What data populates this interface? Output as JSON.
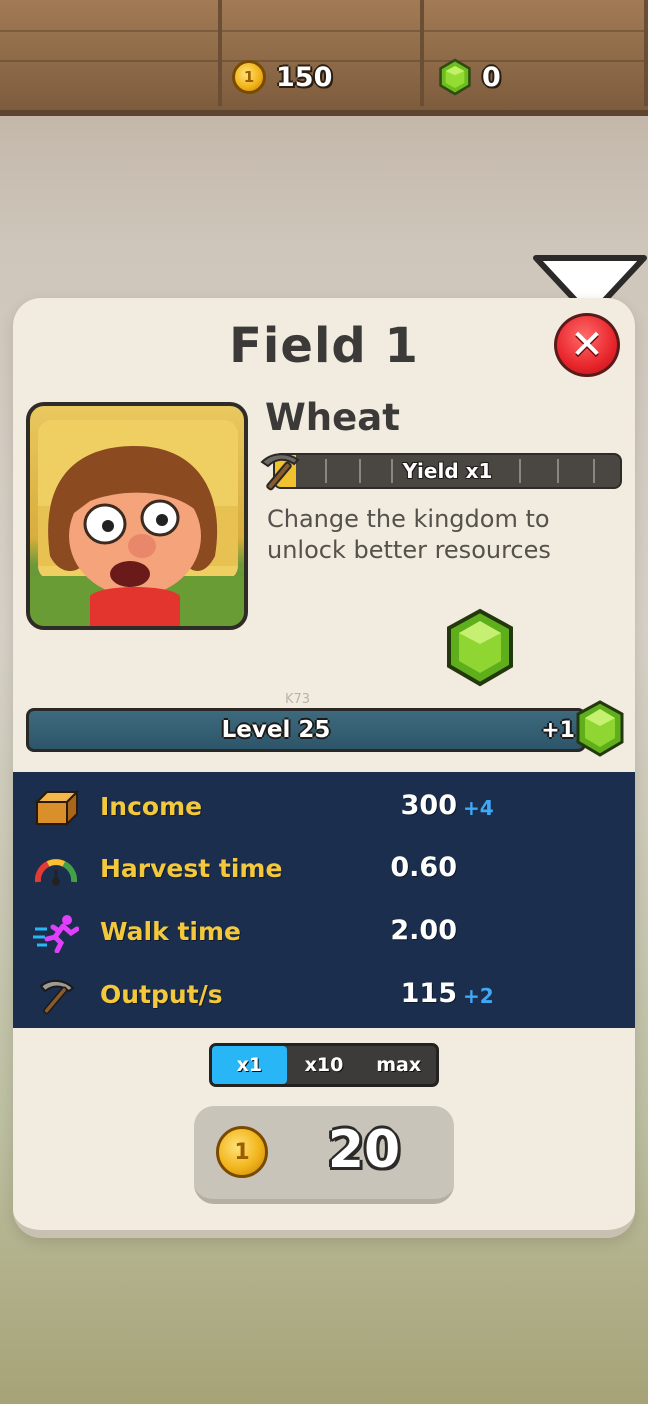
{
  "hud": {
    "coins": "150",
    "gems": "0",
    "coin_icon": "gold-coin-icon",
    "gem_icon": "green-gem-icon"
  },
  "panel": {
    "title": "Field 1",
    "close_icon": "close-x-icon"
  },
  "crop": {
    "name": "Wheat",
    "yield_label": "Yield x1",
    "yield_progress": 0.06,
    "description_line1": "Change the kingdom to",
    "description_line2": "unlock better resources"
  },
  "level": {
    "label": "Level 25",
    "bonus": "+1"
  },
  "stats": [
    {
      "label": "Income",
      "value": "300",
      "bonus": "+4",
      "icon": "wood-crate-icon"
    },
    {
      "label": "Harvest time",
      "value": "0.60",
      "bonus": "",
      "icon": "gauge-icon"
    },
    {
      "label": "Walk time",
      "value": "2.00",
      "bonus": "",
      "icon": "running-man-icon"
    },
    {
      "label": "Output/s",
      "value": "115",
      "bonus": "+2",
      "icon": "pickaxe-icon"
    }
  ],
  "multiplier": {
    "options": [
      "x1",
      "x10",
      "max"
    ],
    "selected": "x1"
  },
  "buy": {
    "price": "20"
  },
  "watermark": "K73",
  "colors": {
    "stat_label": "#f3c83a",
    "stats_bg": "#1b2e4d",
    "bonus": "#3fa9f5",
    "toggle_active": "#29b6f6",
    "close_red": "#e8262c"
  }
}
